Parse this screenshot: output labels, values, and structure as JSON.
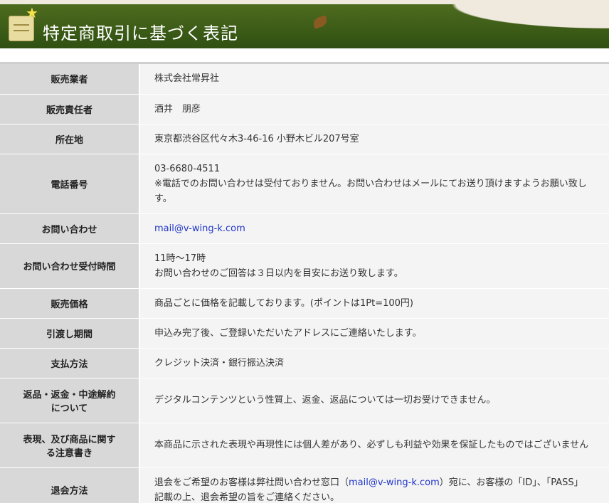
{
  "header": {
    "title": "特定商取引に基づく表記"
  },
  "table": {
    "rows": [
      {
        "label": "販売業者",
        "lines": [
          "株式会社常昇社"
        ]
      },
      {
        "label": "販売責任者",
        "lines": [
          "酒井　朋彦"
        ]
      },
      {
        "label": "所在地",
        "lines": [
          "東京都渋谷区代々木3-46-16 小野木ビル207号室"
        ]
      },
      {
        "label": "電話番号",
        "lines": [
          "03-6680-4511",
          "※電話でのお問い合わせは受付ておりません。お問い合わせはメールにてお送り頂けますようお願い致し",
          "す。"
        ]
      },
      {
        "label": "お問い合わせ",
        "email": "mail@v-wing-k.com"
      },
      {
        "label": "お問い合わせ受付時間",
        "lines": [
          "11時～17時",
          "お問い合わせのご回答は３日以内を目安にお送り致します。"
        ]
      },
      {
        "label": "販売価格",
        "lines": [
          "商品ごとに価格を記載しております。(ポイントは1Pt=100円)"
        ]
      },
      {
        "label": "引渡し期間",
        "lines": [
          "申込み完了後、ご登録いただいたアドレスにご連絡いたします。"
        ]
      },
      {
        "label": "支払方法",
        "lines": [
          "クレジット決済・銀行振込決済"
        ]
      },
      {
        "label_line1": "返品・返金・中途解約",
        "label_line2": "について",
        "lines": [
          "デジタルコンテンツという性質上、返金、返品については一切お受けできません。"
        ]
      },
      {
        "label_line1": "表現、及び商品に関す",
        "label_line2": "る注意書き",
        "lines": [
          "本商品に示された表現や再現性には個人差があり、必ずしも利益や効果を保証したものではございません"
        ]
      },
      {
        "label": "退会方法",
        "pre": "退会をご希望のお客様は弊社問い合わせ窓口（",
        "email": "mail@v-wing-k.com",
        "post": "）宛に、お客様の「ID」、「PASS」",
        "line2": "記載の上、退会希望の旨をご連絡ください。"
      }
    ]
  }
}
